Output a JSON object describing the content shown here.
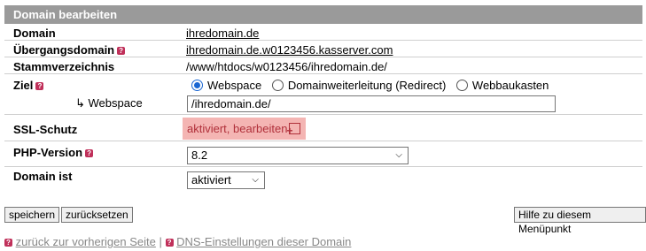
{
  "header": {
    "title": "Domain bearbeiten"
  },
  "rows": {
    "domain": {
      "label": "Domain",
      "value": "ihredomain.de"
    },
    "transition": {
      "label": "Übergangsdomain",
      "value": "ihredomain.de.w0123456.kasserver.com"
    },
    "root": {
      "label": "Stammverzeichnis",
      "value": "/www/htdocs/w0123456/ihredomain.de/"
    },
    "target": {
      "label": "Ziel",
      "options": [
        "Webspace",
        "Domainweiterleitung (Redirect)",
        "Webbaukasten"
      ],
      "selected": "Webspace"
    },
    "webspace": {
      "label": "↳ Webspace",
      "value": "/ihredomain.de/"
    },
    "ssl": {
      "label": "SSL-Schutz",
      "value": "aktiviert, bearbeiten"
    },
    "php": {
      "label": "PHP-Version",
      "value": "8.2"
    },
    "status": {
      "label": "Domain ist",
      "value": "aktiviert"
    }
  },
  "buttons": {
    "save": "speichern",
    "reset": "zurücksetzen",
    "help": "Hilfe zu diesem Menüpunkt"
  },
  "footer": {
    "back": "zurück zur vorherigen Seite",
    "sep": "|",
    "dns": "DNS-Einstellungen dieser Domain"
  },
  "colors": {
    "header_bg": "#9a9a9a",
    "ssl_bg": "#f4b5b3",
    "ssl_text": "#b0303a",
    "accent": "#1a66d2",
    "help_icon": "#c0305a"
  }
}
